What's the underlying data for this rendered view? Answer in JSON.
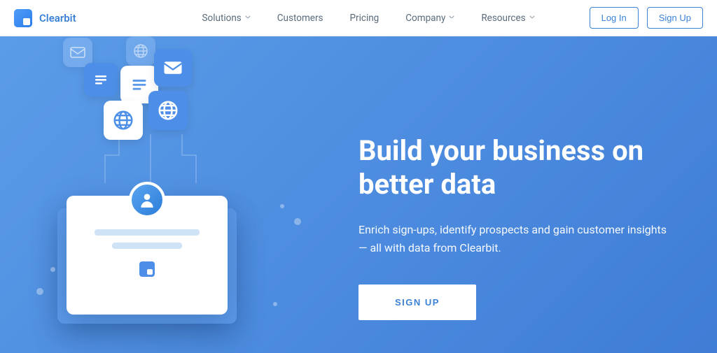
{
  "brand": "Clearbit",
  "nav": {
    "items": [
      {
        "label": "Solutions",
        "has_dropdown": true
      },
      {
        "label": "Customers",
        "has_dropdown": false
      },
      {
        "label": "Pricing",
        "has_dropdown": false
      },
      {
        "label": "Company",
        "has_dropdown": true
      },
      {
        "label": "Resources",
        "has_dropdown": true
      }
    ],
    "login": "Log In",
    "signup": "Sign Up"
  },
  "hero": {
    "title": "Build your business on better data",
    "subtitle": "Enrich sign-ups, identify prospects and gain customer insights — all with data from Clearbit.",
    "cta": "SIGN UP"
  },
  "colors": {
    "primary": "#3b82d6",
    "hero_bg_start": "#5b9ce8",
    "hero_bg_end": "#3f7dd6"
  }
}
